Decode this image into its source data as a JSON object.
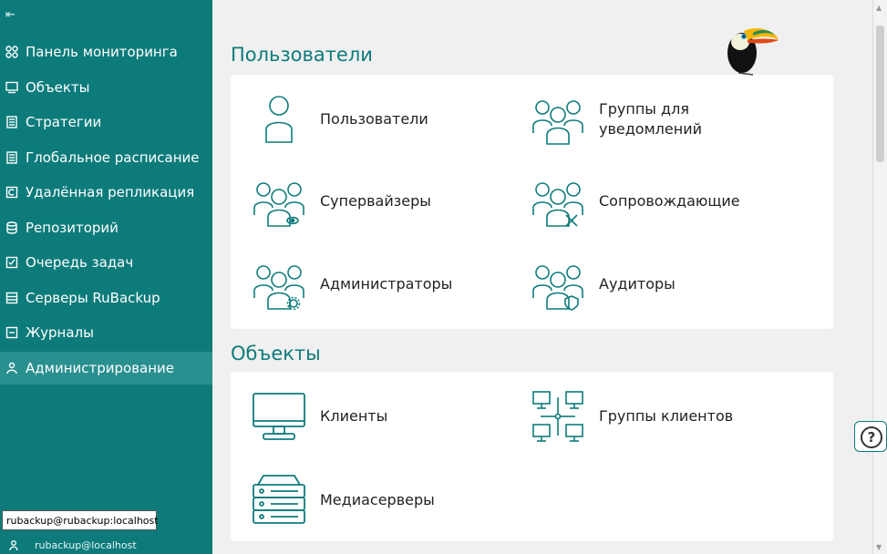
{
  "sidebar": {
    "items": [
      {
        "label": "Панель мониторинга",
        "icon": "dashboard-icon"
      },
      {
        "label": "Объекты",
        "icon": "monitor-icon"
      },
      {
        "label": "Стратегии",
        "icon": "document-icon"
      },
      {
        "label": "Глобальное расписание",
        "icon": "schedule-icon"
      },
      {
        "label": "Удалённая репликация",
        "icon": "replication-icon"
      },
      {
        "label": "Репозиторий",
        "icon": "database-icon"
      },
      {
        "label": "Очередь задач",
        "icon": "queue-icon"
      },
      {
        "label": "Серверы RuBackup",
        "icon": "server-icon"
      },
      {
        "label": "Журналы",
        "icon": "log-icon"
      },
      {
        "label": "Администрирование",
        "icon": "admin-icon"
      }
    ],
    "tooltip": "rubackup@rubackup:localhost",
    "user": "rubackup@localhost"
  },
  "sections": {
    "users": {
      "title": "Пользователи",
      "tiles": [
        {
          "label": "Пользователи",
          "icon": "user-icon"
        },
        {
          "label": "Группы для\nуведомлений",
          "icon": "notification-groups-icon"
        },
        {
          "label": "Супервайзеры",
          "icon": "supervisors-icon"
        },
        {
          "label": "Сопровождающие",
          "icon": "maintainers-icon"
        },
        {
          "label": "Администраторы",
          "icon": "administrators-icon"
        },
        {
          "label": "Аудиторы",
          "icon": "auditors-icon"
        }
      ]
    },
    "objects": {
      "title": "Объекты",
      "tiles": [
        {
          "label": "Клиенты",
          "icon": "clients-icon"
        },
        {
          "label": "Группы клиентов",
          "icon": "client-groups-icon"
        },
        {
          "label": "Медиасерверы",
          "icon": "media-servers-icon"
        }
      ]
    }
  },
  "colors": {
    "accent": "#0e7b7b",
    "sidebar_active": "#2a8f8f",
    "background": "#f0f0f0"
  }
}
